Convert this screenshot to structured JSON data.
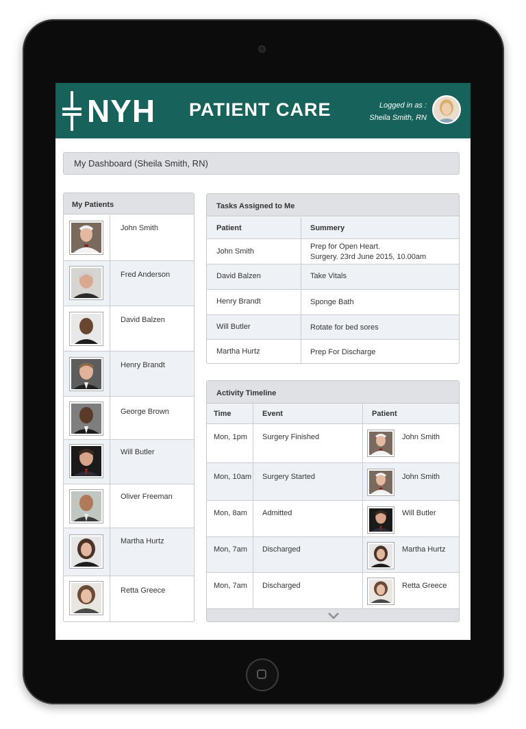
{
  "header": {
    "logo_text": "NYH",
    "app_title": "PATIENT CARE",
    "logged_in_label": "Logged in as :",
    "logged_in_user": "Sheila Smith, RN",
    "brand_color": "#17625a"
  },
  "dashboard": {
    "title": "My Dashboard (Sheila Smith, RN)"
  },
  "patients": {
    "title": "My Patients",
    "items": [
      {
        "name": "John Smith"
      },
      {
        "name": "Fred Anderson"
      },
      {
        "name": "David Balzen"
      },
      {
        "name": "Henry Brandt"
      },
      {
        "name": "George Brown"
      },
      {
        "name": "Will Butler"
      },
      {
        "name": "Oliver Freeman"
      },
      {
        "name": "Martha Hurtz"
      },
      {
        "name": "Retta Greece"
      }
    ]
  },
  "tasks": {
    "title": "Tasks Assigned to Me",
    "columns": [
      "Patient",
      "Summery"
    ],
    "rows": [
      {
        "patient": "John Smith",
        "summary_line1": "Prep for Open Heart.",
        "summary_line2": "Surgery. 23rd June 2015, 10.00am"
      },
      {
        "patient": "David Balzen",
        "summary_line1": "Take Vitals",
        "summary_line2": ""
      },
      {
        "patient": "Henry Brandt",
        "summary_line1": "Sponge Bath",
        "summary_line2": ""
      },
      {
        "patient": "Will Butler",
        "summary_line1": "Rotate for bed sores",
        "summary_line2": ""
      },
      {
        "patient": "Martha Hurtz",
        "summary_line1": "Prep For Discharge",
        "summary_line2": ""
      }
    ]
  },
  "timeline": {
    "title": "Activity Timeline",
    "columns": [
      "Time",
      "Event",
      "Patient"
    ],
    "rows": [
      {
        "time": "Mon, 1pm",
        "event": "Surgery Finished",
        "patient": "John Smith"
      },
      {
        "time": "Mon, 10am",
        "event": "Surgery Started",
        "patient": "John Smith"
      },
      {
        "time": "Mon, 8am",
        "event": "Admitted",
        "patient": "Will Butler"
      },
      {
        "time": "Mon, 7am",
        "event": "Discharged",
        "patient": "Martha Hurtz"
      },
      {
        "time": "Mon, 7am",
        "event": "Discharged",
        "patient": "Retta Greece"
      }
    ]
  },
  "icons": {
    "logo": "nyh-logo-icon",
    "avatar": "user-avatar",
    "scroll": "chevron-down-icon"
  }
}
